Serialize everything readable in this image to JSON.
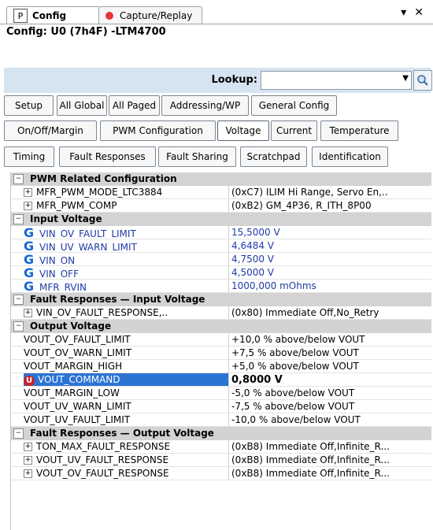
{
  "tabs": [
    {
      "badge": "P",
      "label": "Config"
    },
    {
      "label": "Capture/Replay"
    }
  ],
  "window_controls": {
    "menu": "▾",
    "close": "✕"
  },
  "config_title": "Config: U0 (7h4F) -LTM4700",
  "lookup": {
    "label": "Lookup:",
    "value": ""
  },
  "buttons": {
    "row1": [
      "Setup",
      "All Global",
      "All Paged",
      "Addressing/WP",
      "General Config"
    ],
    "row2": [
      "On/Off/Margin",
      "PWM Configuration",
      "Voltage",
      "Current",
      "Temperature"
    ],
    "row3": [
      "Timing",
      "Fault Responses",
      "Fault Sharing",
      "Scratchpad",
      "Identification"
    ],
    "active": "Voltage"
  },
  "grid": {
    "sections": [
      {
        "title": "PWM Related Configuration",
        "rows": [
          {
            "name": "MFR_PWM_MODE_LTC3884",
            "value": "(0xC7) ILIM Hi Range, Servo En,..",
            "expand": true
          },
          {
            "name": "MFR_PWM_COMP",
            "value": "(0xB2) GM_4P36, R_ITH_8P00",
            "expand": true
          }
        ]
      },
      {
        "title": "Input Voltage",
        "rows": [
          {
            "name": "VIN_OV_FAULT_LIMIT",
            "value": "15,5000 V",
            "icon": "G"
          },
          {
            "name": "VIN_UV_WARN_LIMIT",
            "value": "4,6484 V",
            "icon": "G"
          },
          {
            "name": "VIN_ON",
            "value": "4,7500 V",
            "icon": "G"
          },
          {
            "name": "VIN_OFF",
            "value": "4,5000 V",
            "icon": "G"
          },
          {
            "name": "MFR_RVIN",
            "value": "1000,000 mOhms",
            "icon": "G"
          }
        ]
      },
      {
        "title": "Fault Responses — Input Voltage",
        "rows": [
          {
            "name": "VIN_OV_FAULT_RESPONSE,..",
            "value": "(0x80) Immediate Off,No_Retry",
            "expand": true
          }
        ]
      },
      {
        "title": "Output Voltage",
        "rows": [
          {
            "name": "VOUT_OV_FAULT_LIMIT",
            "value": "+10,0 % above/below VOUT"
          },
          {
            "name": "VOUT_OV_WARN_LIMIT",
            "value": "+7,5 % above/below VOUT"
          },
          {
            "name": "VOUT_MARGIN_HIGH",
            "value": "+5,0 % above/below VOUT"
          },
          {
            "name": "VOUT_COMMAND",
            "value": "0,8000 V",
            "icon": "U",
            "selected": true
          },
          {
            "name": "VOUT_MARGIN_LOW",
            "value": "-5,0 % above/below VOUT"
          },
          {
            "name": "VOUT_UV_WARN_LIMIT",
            "value": "-7,5 % above/below VOUT"
          },
          {
            "name": "VOUT_UV_FAULT_LIMIT",
            "value": "-10,0 % above/below VOUT"
          }
        ]
      },
      {
        "title": "Fault Responses — Output Voltage",
        "rows": [
          {
            "name": "TON_MAX_FAULT_RESPONSE",
            "value": "(0xB8) Immediate Off,Infinite_R...",
            "expand": true
          },
          {
            "name": "VOUT_UV_FAULT_RESPONSE",
            "value": "(0xB8) Immediate Off,Infinite_R...",
            "expand": true
          },
          {
            "name": "VOUT_OV_FAULT_RESPONSE",
            "value": "(0xB8) Immediate Off,Infinite_R...",
            "expand": true
          }
        ]
      }
    ]
  }
}
